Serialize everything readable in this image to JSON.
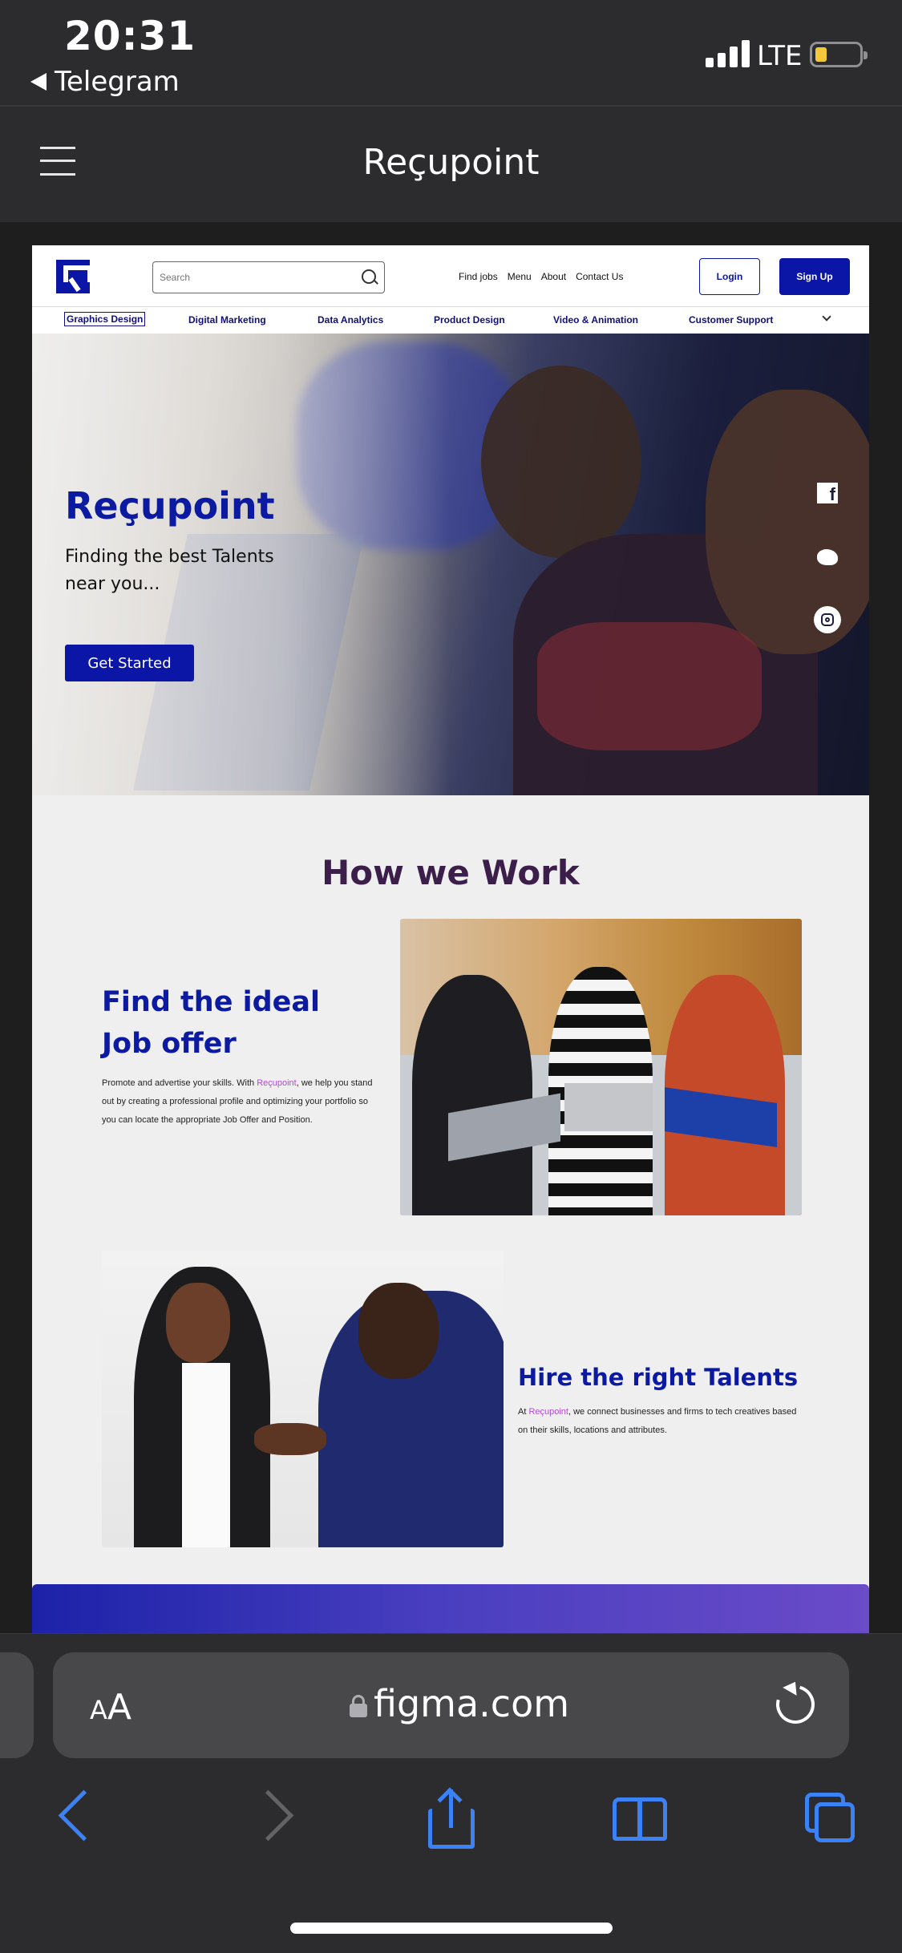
{
  "status_bar": {
    "time": "20:31",
    "back_app": "Telegram",
    "network": "LTE",
    "battery_level": 0.25,
    "battery_color": "#f5c83a"
  },
  "app_header": {
    "title": "Reçupoint",
    "menu_icon": "hamburger-icon"
  },
  "site": {
    "nav": {
      "search_placeholder": "Search",
      "links": [
        "Find jobs",
        "Menu",
        "About",
        "Contact Us"
      ],
      "login_label": "Login",
      "signup_label": "Sign Up"
    },
    "categories": [
      "Graphics Design",
      "Digital Marketing",
      "Data Analytics",
      "Product Design",
      "Video & Animation",
      "Customer Support"
    ],
    "active_category": "Graphics Design",
    "hero": {
      "title": "Reçupoint",
      "subtitle": "Finding the best Talents near you...",
      "cta_label": "Get Started",
      "social_icons": [
        "facebook-icon",
        "twitter-icon",
        "instagram-icon"
      ]
    },
    "how": {
      "title": "How we Work",
      "feature1": {
        "title": "Find the ideal Job offer",
        "text_before": "Promote and advertise your skills. With ",
        "highlight": "Reçupoint",
        "text_after": ", we help you stand out by creating a professional profile and optimizing your portfolio so you can locate the appropriate Job Offer and Position."
      },
      "feature2": {
        "title": "Hire the right Talents",
        "text_before": "At ",
        "highlight": "Reçupoint",
        "text_after": ", we connect businesses and firms to tech creatives based on their skills, locations and attributes."
      }
    },
    "colors": {
      "brand": "#0b16a6",
      "heading": "#3b1f4a",
      "highlight": "#b04bd6"
    }
  },
  "browser": {
    "text_size_label_small": "A",
    "text_size_label_large": "A",
    "domain": "figma.com",
    "toolbar_icons": [
      "back-icon",
      "forward-icon",
      "share-icon",
      "bookmarks-icon",
      "tabs-icon"
    ],
    "accent": "#3b82f6"
  }
}
